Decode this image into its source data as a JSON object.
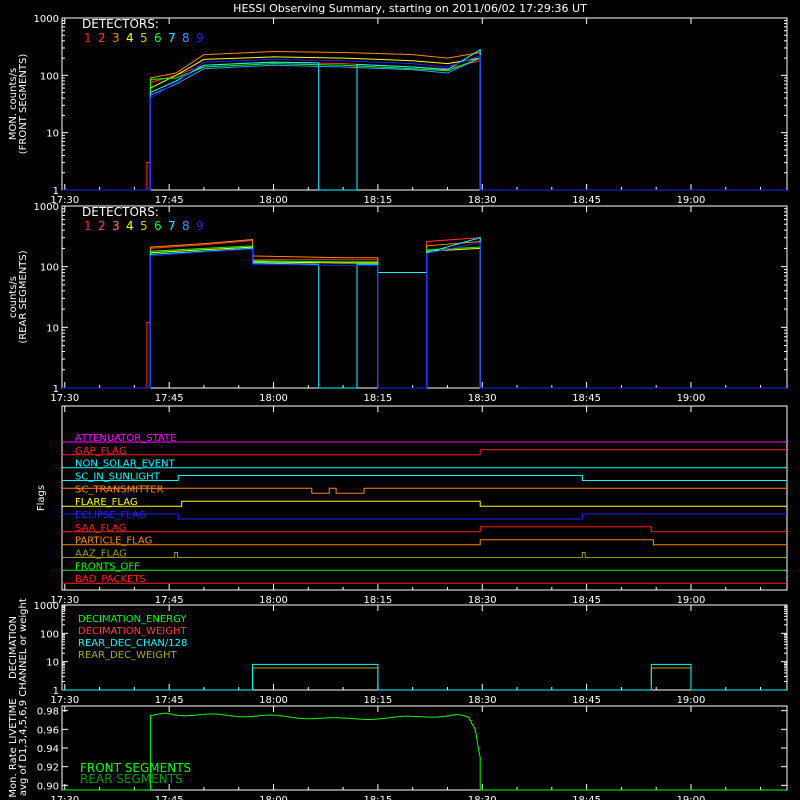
{
  "chart_data": {
    "title": "HESSI Observing Summary, starting on 2011/06/02 17:29:36 UT",
    "x_tick_labels": [
      "17:30",
      "17:45",
      "18:00",
      "18:15",
      "18:30",
      "18:45",
      "19:00"
    ],
    "x_ticks": [
      30,
      45,
      60,
      75,
      90,
      105,
      120
    ],
    "x_range": [
      29.6,
      133.8
    ],
    "x_units": "minutes after 17:00 UT",
    "panels": [
      {
        "id": "front",
        "type": "line",
        "ylabel_lines": [
          "MON. counts/s",
          "(FRONT SEGMENTS)"
        ],
        "yscale": "log",
        "ylim": [
          1,
          1000
        ],
        "y_tick_labels": [
          "1",
          "10",
          "100",
          "1000"
        ],
        "legend_title": "DETECTORS:",
        "detector_labels": [
          "1",
          "2",
          "3",
          "4",
          "5",
          "6",
          "7",
          "8",
          "9"
        ],
        "detector_colors": [
          "#ff3030",
          "#ff4040",
          "#ff8800",
          "#ffff00",
          "#cccc00",
          "#00ff00",
          "#00ffff",
          "#3399ff",
          "#2222ff"
        ],
        "series": [
          {
            "color": "#ff3030",
            "x": [
              29.6,
              41.8,
              41.8,
              42.3,
              42.3,
              46,
              50,
              60,
              70,
              80,
              85,
              89.7,
              89.7,
              133.8
            ],
            "y": [
              1,
              1,
              3,
              3,
              75,
              100,
              150,
              170,
              160,
              140,
              130,
              180,
              1,
              1
            ]
          },
          {
            "color": "#ff8800",
            "x": [
              29.6,
              42.3,
              42.3,
              46,
              50,
              60,
              70,
              80,
              85,
              89.7,
              89.7,
              133.8
            ],
            "y": [
              1,
              1,
              90,
              110,
              230,
              260,
              250,
              230,
              200,
              250,
              1,
              1
            ]
          },
          {
            "color": "#ffff00",
            "x": [
              29.6,
              42.3,
              42.3,
              46,
              50,
              60,
              70,
              80,
              85,
              89.7,
              89.7,
              133.8
            ],
            "y": [
              1,
              1,
              60,
              100,
              190,
              210,
              200,
              180,
              160,
              200,
              1,
              1
            ]
          },
          {
            "color": "#00ff00",
            "x": [
              29.6,
              42.3,
              42.3,
              46,
              50,
              60,
              70,
              80,
              85,
              89.7,
              89.7,
              133.8
            ],
            "y": [
              1,
              1,
              85,
              90,
              140,
              160,
              150,
              130,
              120,
              200,
              1,
              1
            ]
          },
          {
            "color": "#00ffff",
            "x": [
              29.6,
              42.3,
              42.3,
              46,
              50,
              60,
              66.5,
              66.5,
              72,
              72,
              80,
              85,
              89.7,
              89.7,
              133.8
            ],
            "y": [
              1,
              1,
              50,
              80,
              150,
              170,
              165,
              1,
              1,
              155,
              140,
              125,
              280,
              1,
              1
            ]
          },
          {
            "color": "#3399ff",
            "x": [
              29.6,
              42.3,
              42.3,
              46,
              50,
              60,
              70,
              80,
              85,
              89.7,
              89.7,
              133.8
            ],
            "y": [
              1,
              1,
              45,
              70,
              130,
              150,
              140,
              125,
              110,
              200,
              1,
              1
            ]
          },
          {
            "color": "#2222ff",
            "x": [
              29.6,
              42.3,
              42.3,
              46,
              50,
              60,
              70,
              80,
              85,
              89.7,
              89.7,
              133.8
            ],
            "y": [
              1,
              1,
              40,
              75,
              170,
              190,
              180,
              160,
              140,
              220,
              1,
              1
            ]
          }
        ]
      },
      {
        "id": "rear",
        "type": "line",
        "ylabel_lines": [
          "counts/s",
          "(REAR SEGMENTS)"
        ],
        "yscale": "log",
        "ylim": [
          1,
          1000
        ],
        "y_tick_labels": [
          "1",
          "10",
          "100",
          "1000"
        ],
        "legend_title": "DETECTORS:",
        "detector_labels": [
          "1",
          "2",
          "3",
          "4",
          "5",
          "6",
          "7",
          "8",
          "9"
        ],
        "detector_colors": [
          "#ff3030",
          "#ff4040",
          "#ff8800",
          "#ffff00",
          "#cccc00",
          "#00ff00",
          "#00ffff",
          "#3399ff",
          "#2222ff"
        ],
        "series": [
          {
            "color": "#ff3030",
            "x": [
              29.6,
              41.8,
              41.8,
              42.3,
              42.3,
              50,
              57,
              57,
              70,
              75,
              75,
              82,
              82,
              89.7,
              89.7,
              133.8
            ],
            "y": [
              1,
              1,
              12,
              12,
              200,
              230,
              270,
              130,
              130,
              130,
              1,
              1,
              260,
              300,
              1,
              1
            ]
          },
          {
            "color": "#ff8800",
            "x": [
              29.6,
              42.3,
              42.3,
              50,
              57,
              57,
              70,
              75,
              75,
              82,
              82,
              89.7,
              89.7,
              133.8
            ],
            "y": [
              1,
              1,
              210,
              240,
              280,
              150,
              140,
              140,
              1,
              1,
              220,
              260,
              1,
              1
            ]
          },
          {
            "color": "#ffff00",
            "x": [
              29.6,
              42.3,
              42.3,
              50,
              57,
              57,
              70,
              75,
              75,
              82,
              82,
              89.7,
              89.7,
              133.8
            ],
            "y": [
              1,
              1,
              170,
              190,
              210,
              120,
              115,
              115,
              1,
              1,
              180,
              200,
              1,
              1
            ]
          },
          {
            "color": "#00ff00",
            "x": [
              29.6,
              42.3,
              42.3,
              50,
              57,
              57,
              70,
              75,
              75,
              82,
              82,
              89.7,
              89.7,
              133.8
            ],
            "y": [
              1,
              1,
              180,
              200,
              220,
              125,
              120,
              120,
              1,
              1,
              190,
              210,
              1,
              1
            ]
          },
          {
            "color": "#00ffff",
            "x": [
              29.6,
              42.3,
              42.3,
              50,
              57,
              57,
              66.5,
              66.5,
              72,
              72,
              75,
              75,
              82,
              82,
              89.7,
              89.7,
              133.8
            ],
            "y": [
              1,
              1,
              160,
              180,
              200,
              115,
              110,
              1,
              1,
              110,
              110,
              80,
              80,
              170,
              300,
              1,
              1
            ]
          },
          {
            "color": "#2222ff",
            "x": [
              29.6,
              42.3,
              42.3,
              50,
              57,
              57,
              70,
              75,
              75,
              82,
              82,
              89.7,
              89.7,
              133.8
            ],
            "y": [
              1,
              1,
              150,
              175,
              195,
              110,
              105,
              105,
              1,
              1,
              165,
              250,
              1,
              1
            ]
          }
        ]
      },
      {
        "id": "flags",
        "type": "step",
        "ylabel": "Flags",
        "flags": [
          {
            "name": "ATTENUATOR_STATE",
            "color": "#ff00ff",
            "x": [
              29.6,
              133.8
            ],
            "v": [
              0,
              0
            ]
          },
          {
            "name": "GAP_FLAG",
            "color": "#ff2020",
            "x": [
              29.6,
              89.7,
              89.7,
              133.8
            ],
            "v": [
              0,
              0,
              1,
              1
            ]
          },
          {
            "name": "NON_SOLAR_EVENT",
            "color": "#00ffff",
            "x": [
              29.6,
              133.8
            ],
            "v": [
              0,
              0
            ]
          },
          {
            "name": "SC_IN_SUNLIGHT",
            "color": "#00ffff",
            "x": [
              29.6,
              46.3,
              46.3,
              104.4,
              104.4,
              133.8
            ],
            "v": [
              0,
              0,
              1,
              1,
              0,
              0
            ]
          },
          {
            "name": "SC_TRANSMITTER",
            "color": "#ff8800",
            "x": [
              29.6,
              65.5,
              65.5,
              68,
              68,
              69,
              69,
              73,
              73,
              133.8
            ],
            "v": [
              1,
              1,
              0,
              0,
              1,
              1,
              0,
              0,
              1,
              1
            ]
          },
          {
            "name": "FLARE_FLAG",
            "color": "#ffff00",
            "x": [
              29.6,
              46.8,
              46.8,
              89.7,
              89.7,
              133.8
            ],
            "v": [
              0,
              0,
              1,
              1,
              0,
              0
            ]
          },
          {
            "name": "ECLIPSE_FLAG",
            "color": "#2020ff",
            "x": [
              29.6,
              46.3,
              46.3,
              104.4,
              104.4,
              133.8
            ],
            "v": [
              1,
              1,
              0,
              0,
              1,
              1
            ]
          },
          {
            "name": "SAA_FLAG",
            "color": "#ff2020",
            "x": [
              29.6,
              89.7,
              89.7,
              114.3,
              114.3,
              133.8
            ],
            "v": [
              0,
              0,
              1,
              1,
              0,
              0
            ]
          },
          {
            "name": "PARTICLE_FLAG",
            "color": "#ff8800",
            "x": [
              29.6,
              89.7,
              89.7,
              114.6,
              114.6,
              133.8
            ],
            "v": [
              0,
              0,
              1,
              1,
              0,
              0
            ]
          },
          {
            "name": "AAZ_FLAG",
            "color": "#999900",
            "x": [
              29.6,
              45.8,
              45.8,
              46.2,
              46.2,
              104.4,
              104.4,
              104.8,
              104.8,
              133.8
            ],
            "v": [
              0,
              0,
              1,
              1,
              0,
              0,
              1,
              1,
              0,
              0
            ]
          },
          {
            "name": "FRONTS_OFF",
            "color": "#00ff00",
            "x": [
              29.6,
              133.8
            ],
            "v": [
              0,
              0
            ]
          },
          {
            "name": "BAD_PACKETS",
            "color": "#ff2020",
            "x": [
              29.6,
              133.8
            ],
            "v": [
              0,
              0
            ]
          }
        ]
      },
      {
        "id": "decimation",
        "type": "line",
        "ylabel_lines": [
          "DECIMATION",
          "CHANNEL or weight"
        ],
        "yscale": "log",
        "ylim": [
          1,
          1000
        ],
        "y_tick_labels": [
          "1",
          "10",
          "100",
          "1000"
        ],
        "legend": [
          {
            "name": "DECIMATION_ENERGY",
            "color": "#00ff00"
          },
          {
            "name": "DECIMATION_WEIGHT",
            "color": "#ff4040"
          },
          {
            "name": "REAR_DEC_CHAN/128",
            "color": "#00ffff"
          },
          {
            "name": "REAR_DEC_WEIGHT",
            "color": "#aaaa00"
          }
        ],
        "series": [
          {
            "color": "#aaaa00",
            "x": [
              29.6,
              57,
              57,
              75,
              75,
              114.3,
              114.3,
              120,
              120,
              133.8
            ],
            "y": [
              1,
              1,
              6,
              6,
              1,
              1,
              6,
              6,
              1,
              1
            ]
          },
          {
            "color": "#00ffff",
            "x": [
              29.6,
              57,
              57,
              75,
              75,
              114.3,
              114.3,
              120,
              120,
              133.8
            ],
            "y": [
              1,
              1,
              8,
              8,
              1,
              1,
              8,
              8,
              1,
              1
            ]
          }
        ]
      },
      {
        "id": "livetime",
        "type": "line",
        "ylabel_lines": [
          "Mon. Rate LIVETIME",
          "avg of D1,3,4,5,6,9"
        ],
        "ylim": [
          0.895,
          0.985
        ],
        "y_ticks": [
          0.9,
          0.92,
          0.94,
          0.96,
          0.98
        ],
        "y_tick_labels": [
          "0.90",
          "0.92",
          "0.94",
          "0.96",
          "0.98"
        ],
        "legend": [
          {
            "name": "FRONT SEGMENTS",
            "color": "#00ff00"
          },
          {
            "name": "REAR SEGMENTS",
            "color": "#009900"
          }
        ],
        "series": [
          {
            "color": "#00ff00",
            "x": [
              29.6,
              42.3,
              42.3,
              46,
              60,
              70,
              80,
              85,
              88,
              89,
              89.7,
              89.7,
              133.8
            ],
            "y": [
              0.895,
              0.895,
              0.976,
              0.976,
              0.974,
              0.971,
              0.973,
              0.975,
              0.974,
              0.96,
              0.93,
              0.895,
              0.895
            ]
          }
        ]
      }
    ]
  }
}
